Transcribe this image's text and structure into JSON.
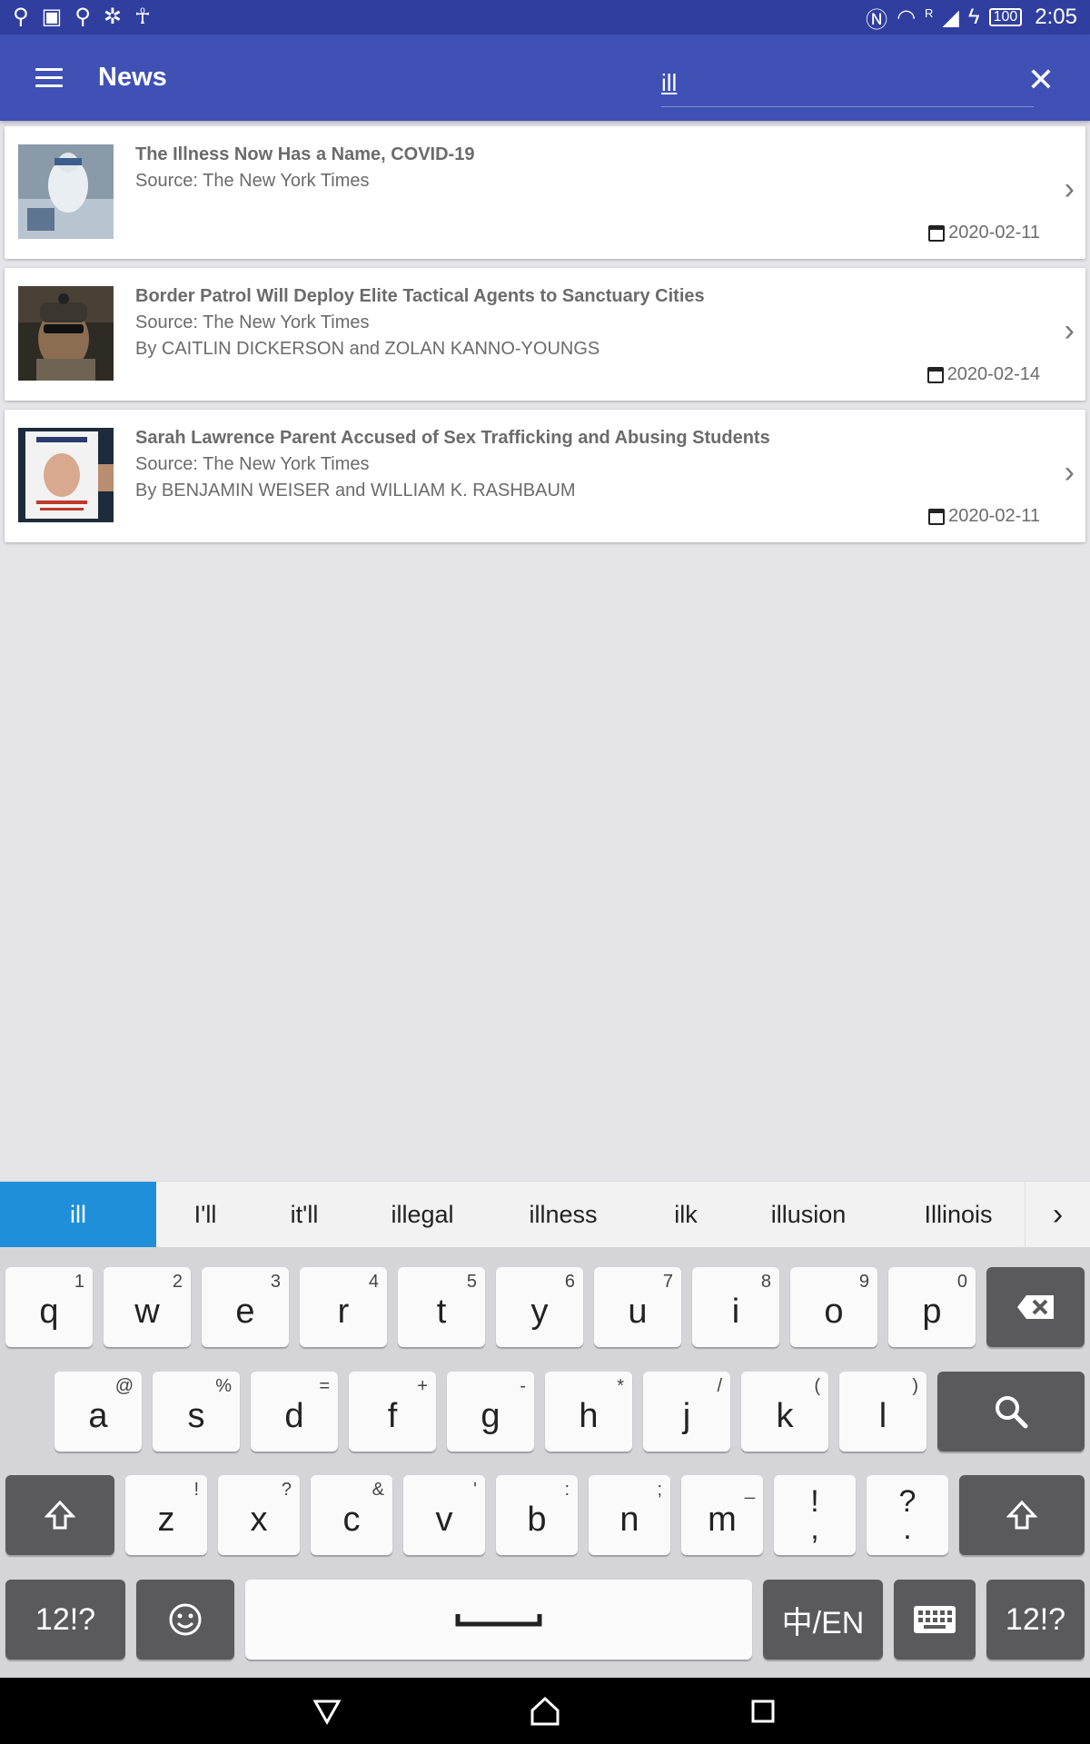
{
  "status_bar": {
    "time": "2:05",
    "battery": "100",
    "signal_marker": "R",
    "left_icons": [
      "usb-icon",
      "image-icon",
      "usb-debug-icon",
      "sync-icon",
      "android-icon"
    ],
    "right_icons": [
      "nfc-icon",
      "wifi-icon",
      "signal-icon",
      "charging-icon",
      "battery-icon"
    ]
  },
  "app_bar": {
    "title": "News",
    "search_value": "ill",
    "menu_icon": "menu-icon",
    "close_icon": "close-icon"
  },
  "articles": [
    {
      "title": "The Illness Now Has a Name, COVID-19",
      "source": "Source: The New York Times",
      "authors": "",
      "date": "2020-02-11"
    },
    {
      "title": "Border Patrol Will Deploy Elite Tactical Agents to Sanctuary Cities",
      "source": "Source: The New York Times",
      "authors": "By CAITLIN DICKERSON and ZOLAN KANNO-YOUNGS",
      "date": "2020-02-14"
    },
    {
      "title": "Sarah Lawrence Parent Accused of Sex Trafficking and Abusing Students",
      "source": "Source: The New York Times",
      "authors": "By BENJAMIN WEISER and WILLIAM K. RASHBAUM",
      "date": "2020-02-11"
    }
  ],
  "suggestions": [
    "ill",
    "I'll",
    "it'll",
    "illegal",
    "illness",
    "ilk",
    "illusion",
    "Illinois"
  ],
  "keyboard": {
    "row1": [
      {
        "k": "q",
        "s": "1"
      },
      {
        "k": "w",
        "s": "2"
      },
      {
        "k": "e",
        "s": "3"
      },
      {
        "k": "r",
        "s": "4"
      },
      {
        "k": "t",
        "s": "5"
      },
      {
        "k": "y",
        "s": "6"
      },
      {
        "k": "u",
        "s": "7"
      },
      {
        "k": "i",
        "s": "8"
      },
      {
        "k": "o",
        "s": "9"
      },
      {
        "k": "p",
        "s": "0"
      }
    ],
    "row2": [
      {
        "k": "a",
        "s": "@"
      },
      {
        "k": "s",
        "s": "%"
      },
      {
        "k": "d",
        "s": "="
      },
      {
        "k": "f",
        "s": "+"
      },
      {
        "k": "g",
        "s": "-"
      },
      {
        "k": "h",
        "s": "*"
      },
      {
        "k": "j",
        "s": "/"
      },
      {
        "k": "k",
        "s": "("
      },
      {
        "k": "l",
        "s": ")"
      }
    ],
    "row3": [
      {
        "k": "z",
        "s": "!"
      },
      {
        "k": "x",
        "s": "?"
      },
      {
        "k": "c",
        "s": "&"
      },
      {
        "k": "v",
        "s": "'"
      },
      {
        "k": "b",
        "s": ":"
      },
      {
        "k": "n",
        "s": ";"
      },
      {
        "k": "m",
        "s": "_"
      },
      {
        "k": "!\n,",
        "s": ""
      },
      {
        "k": "?\n.",
        "s": ""
      }
    ],
    "symbols_label": "12!?",
    "lang_label": "中/EN"
  }
}
